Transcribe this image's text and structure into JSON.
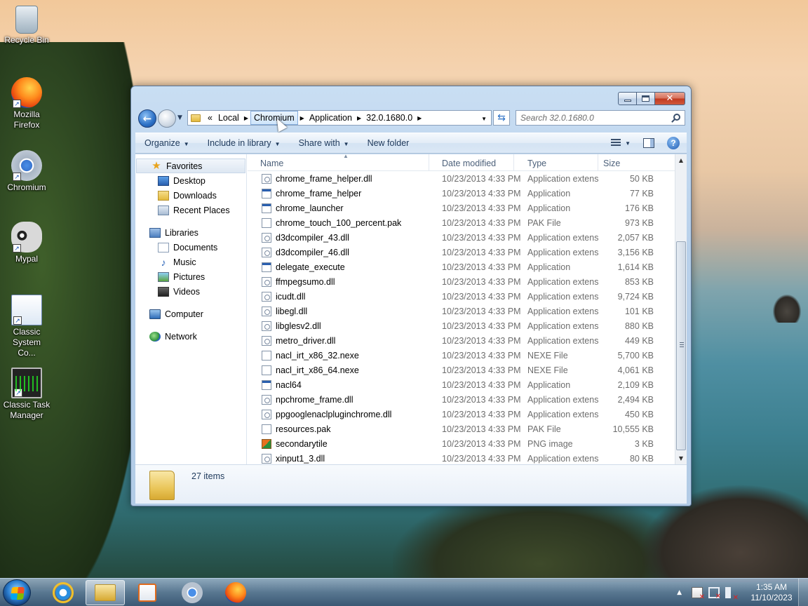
{
  "desktop": {
    "icons": [
      {
        "label": "Recycle Bin",
        "icon": "recycle-bin-icon"
      },
      {
        "label": "Mozilla Firefox",
        "icon": "firefox-icon"
      },
      {
        "label": "Chromium",
        "icon": "chromium-icon"
      },
      {
        "label": "Mypal",
        "icon": "mypal-icon"
      },
      {
        "label": "Classic System Co...",
        "icon": "classic-system-config-icon"
      },
      {
        "label": "Classic Task Manager",
        "icon": "classic-task-manager-icon"
      }
    ]
  },
  "window": {
    "caption": {
      "minimize": "minimize-icon",
      "maximize": "maximize-icon",
      "close": "✕"
    },
    "address": {
      "overflow": "«",
      "crumbs": [
        "Local",
        "Chromium",
        "Application",
        "32.0.1680.0"
      ],
      "search_placeholder": "Search 32.0.1680.0"
    },
    "toolbar": {
      "organize": "Organize",
      "include_in_library": "Include in library",
      "share_with": "Share with",
      "new_folder": "New folder",
      "help": "?"
    },
    "nav": {
      "favorites": "Favorites",
      "desktop": "Desktop",
      "downloads": "Downloads",
      "recent_places": "Recent Places",
      "libraries": "Libraries",
      "documents": "Documents",
      "music": "Music",
      "pictures": "Pictures",
      "videos": "Videos",
      "computer": "Computer",
      "network": "Network"
    },
    "columns": {
      "name": "Name",
      "date": "Date modified",
      "type": "Type",
      "size": "Size"
    },
    "files": [
      {
        "name": "chrome_frame_helper.dll",
        "date": "10/23/2013 4:33 PM",
        "type": "Application extens...",
        "size": "50 KB",
        "kind": "dll"
      },
      {
        "name": "chrome_frame_helper",
        "date": "10/23/2013 4:33 PM",
        "type": "Application",
        "size": "77 KB",
        "kind": "app"
      },
      {
        "name": "chrome_launcher",
        "date": "10/23/2013 4:33 PM",
        "type": "Application",
        "size": "176 KB",
        "kind": "app"
      },
      {
        "name": "chrome_touch_100_percent.pak",
        "date": "10/23/2013 4:33 PM",
        "type": "PAK File",
        "size": "973 KB",
        "kind": "file"
      },
      {
        "name": "d3dcompiler_43.dll",
        "date": "10/23/2013 4:33 PM",
        "type": "Application extens...",
        "size": "2,057 KB",
        "kind": "dll"
      },
      {
        "name": "d3dcompiler_46.dll",
        "date": "10/23/2013 4:33 PM",
        "type": "Application extens...",
        "size": "3,156 KB",
        "kind": "dll"
      },
      {
        "name": "delegate_execute",
        "date": "10/23/2013 4:33 PM",
        "type": "Application",
        "size": "1,614 KB",
        "kind": "app"
      },
      {
        "name": "ffmpegsumo.dll",
        "date": "10/23/2013 4:33 PM",
        "type": "Application extens...",
        "size": "853 KB",
        "kind": "dll"
      },
      {
        "name": "icudt.dll",
        "date": "10/23/2013 4:33 PM",
        "type": "Application extens...",
        "size": "9,724 KB",
        "kind": "dll"
      },
      {
        "name": "libegl.dll",
        "date": "10/23/2013 4:33 PM",
        "type": "Application extens...",
        "size": "101 KB",
        "kind": "dll"
      },
      {
        "name": "libglesv2.dll",
        "date": "10/23/2013 4:33 PM",
        "type": "Application extens...",
        "size": "880 KB",
        "kind": "dll"
      },
      {
        "name": "metro_driver.dll",
        "date": "10/23/2013 4:33 PM",
        "type": "Application extens...",
        "size": "449 KB",
        "kind": "dll"
      },
      {
        "name": "nacl_irt_x86_32.nexe",
        "date": "10/23/2013 4:33 PM",
        "type": "NEXE File",
        "size": "5,700 KB",
        "kind": "file"
      },
      {
        "name": "nacl_irt_x86_64.nexe",
        "date": "10/23/2013 4:33 PM",
        "type": "NEXE File",
        "size": "4,061 KB",
        "kind": "file"
      },
      {
        "name": "nacl64",
        "date": "10/23/2013 4:33 PM",
        "type": "Application",
        "size": "2,109 KB",
        "kind": "app"
      },
      {
        "name": "npchrome_frame.dll",
        "date": "10/23/2013 4:33 PM",
        "type": "Application extens...",
        "size": "2,494 KB",
        "kind": "dll"
      },
      {
        "name": "ppgooglenaclpluginchrome.dll",
        "date": "10/23/2013 4:33 PM",
        "type": "Application extens...",
        "size": "450 KB",
        "kind": "dll"
      },
      {
        "name": "resources.pak",
        "date": "10/23/2013 4:33 PM",
        "type": "PAK File",
        "size": "10,555 KB",
        "kind": "file"
      },
      {
        "name": "secondarytile",
        "date": "10/23/2013 4:33 PM",
        "type": "PNG image",
        "size": "3 KB",
        "kind": "png"
      },
      {
        "name": "xinput1_3.dll",
        "date": "10/23/2013 4:33 PM",
        "type": "Application extens...",
        "size": "80 KB",
        "kind": "dll"
      }
    ],
    "status": {
      "item_count": "27 items"
    }
  },
  "taskbar": {
    "apps": [
      "internet-explorer-icon",
      "windows-explorer-icon",
      "media-player-icon",
      "chromium-icon",
      "firefox-icon"
    ],
    "clock": {
      "time": "1:35 AM",
      "date": "11/10/2023"
    }
  }
}
